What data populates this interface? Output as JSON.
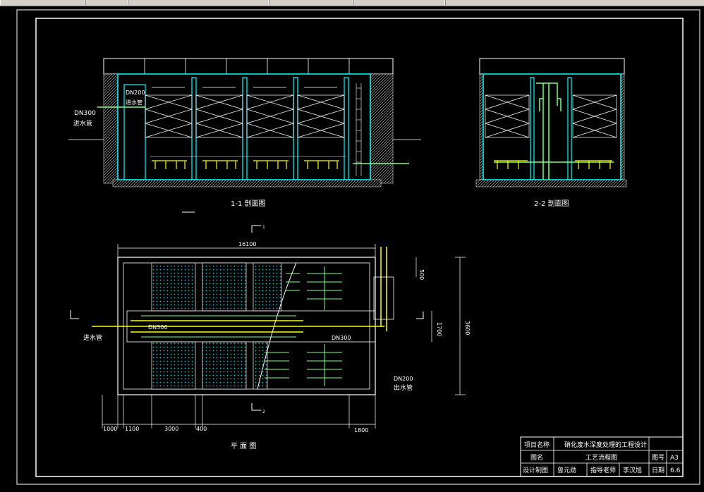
{
  "drawing": {
    "section_1_title": "1-1 剖面图",
    "section_2_title": "2-2 剖面图",
    "plan_title": "平 面 图",
    "labels": {
      "inlet_dn300": "DN300",
      "inlet_text": "进水管",
      "inlet_dn200": "DN200",
      "inlet_dn200_text": "进水管",
      "plan_inlet_text": "进水管",
      "plan_dn300_a": "DN300",
      "plan_dn300_b": "DN300",
      "plan_dn200": "DN200",
      "outlet_text": "出水管",
      "marker_1": "1",
      "marker_2": "2"
    },
    "dimensions": {
      "total_length": "16100",
      "d_500": "500",
      "d_1700": "1700",
      "d_3600": "3600",
      "d_1000": "1000",
      "d_1100": "1100",
      "d_3000": "3000",
      "d_400": "400",
      "d_1800": "1800"
    }
  },
  "title_block": {
    "project_label": "项目名称",
    "project_value": "硝化废水深度处理的工程设计",
    "drawing_label": "图名",
    "drawing_value": "工艺流程图",
    "number_label": "图号",
    "number_value": "A3",
    "designer_label": "设计制图",
    "designer_value": "曾元勋",
    "advisor_label": "指导老师",
    "advisor_value": "李汉旭",
    "date_label": "日期",
    "date_value": "6.6"
  },
  "colors": {
    "background": "#000000",
    "frame": "#ffffff",
    "structure": "#00ffff",
    "pipe": "#ffff00",
    "pipe_green": "#80ff80",
    "media": "#00c8c8"
  }
}
